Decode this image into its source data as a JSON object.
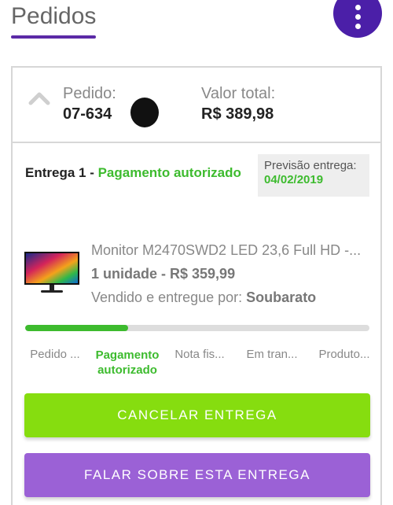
{
  "header": {
    "title": "Pedidos",
    "menu_icon": "more-vert-icon"
  },
  "order": {
    "label": "Pedido:",
    "number": "07-634",
    "total_label": "Valor total:",
    "total_value": "R$ 389,98"
  },
  "delivery": {
    "title": "Entrega 1 -",
    "status": "Pagamento autorizado",
    "forecast_label": "Previsão entrega:",
    "forecast_date": "04/02/2019"
  },
  "product": {
    "name": "Monitor M2470SWD2 LED 23,6 Full HD -...",
    "quantity_price": "1 unidade - R$ 359,99",
    "seller_label": "Vendido e entregue por:",
    "seller_name": "Soubarato"
  },
  "progress": {
    "fraction": 0.3
  },
  "steps": [
    "Pedido ...",
    "Pagamento autorizado",
    "Nota fis...",
    "Em tran...",
    "Produto..."
  ],
  "buttons": {
    "cancel": "CANCELAR ENTREGA",
    "talk": "FALAR SOBRE ESTA ENTREGA"
  },
  "colors": {
    "accent": "#4b1fa8",
    "success": "#3dbb2e",
    "cancel_bg": "#86dd0f",
    "talk_bg": "#9b61d6"
  }
}
